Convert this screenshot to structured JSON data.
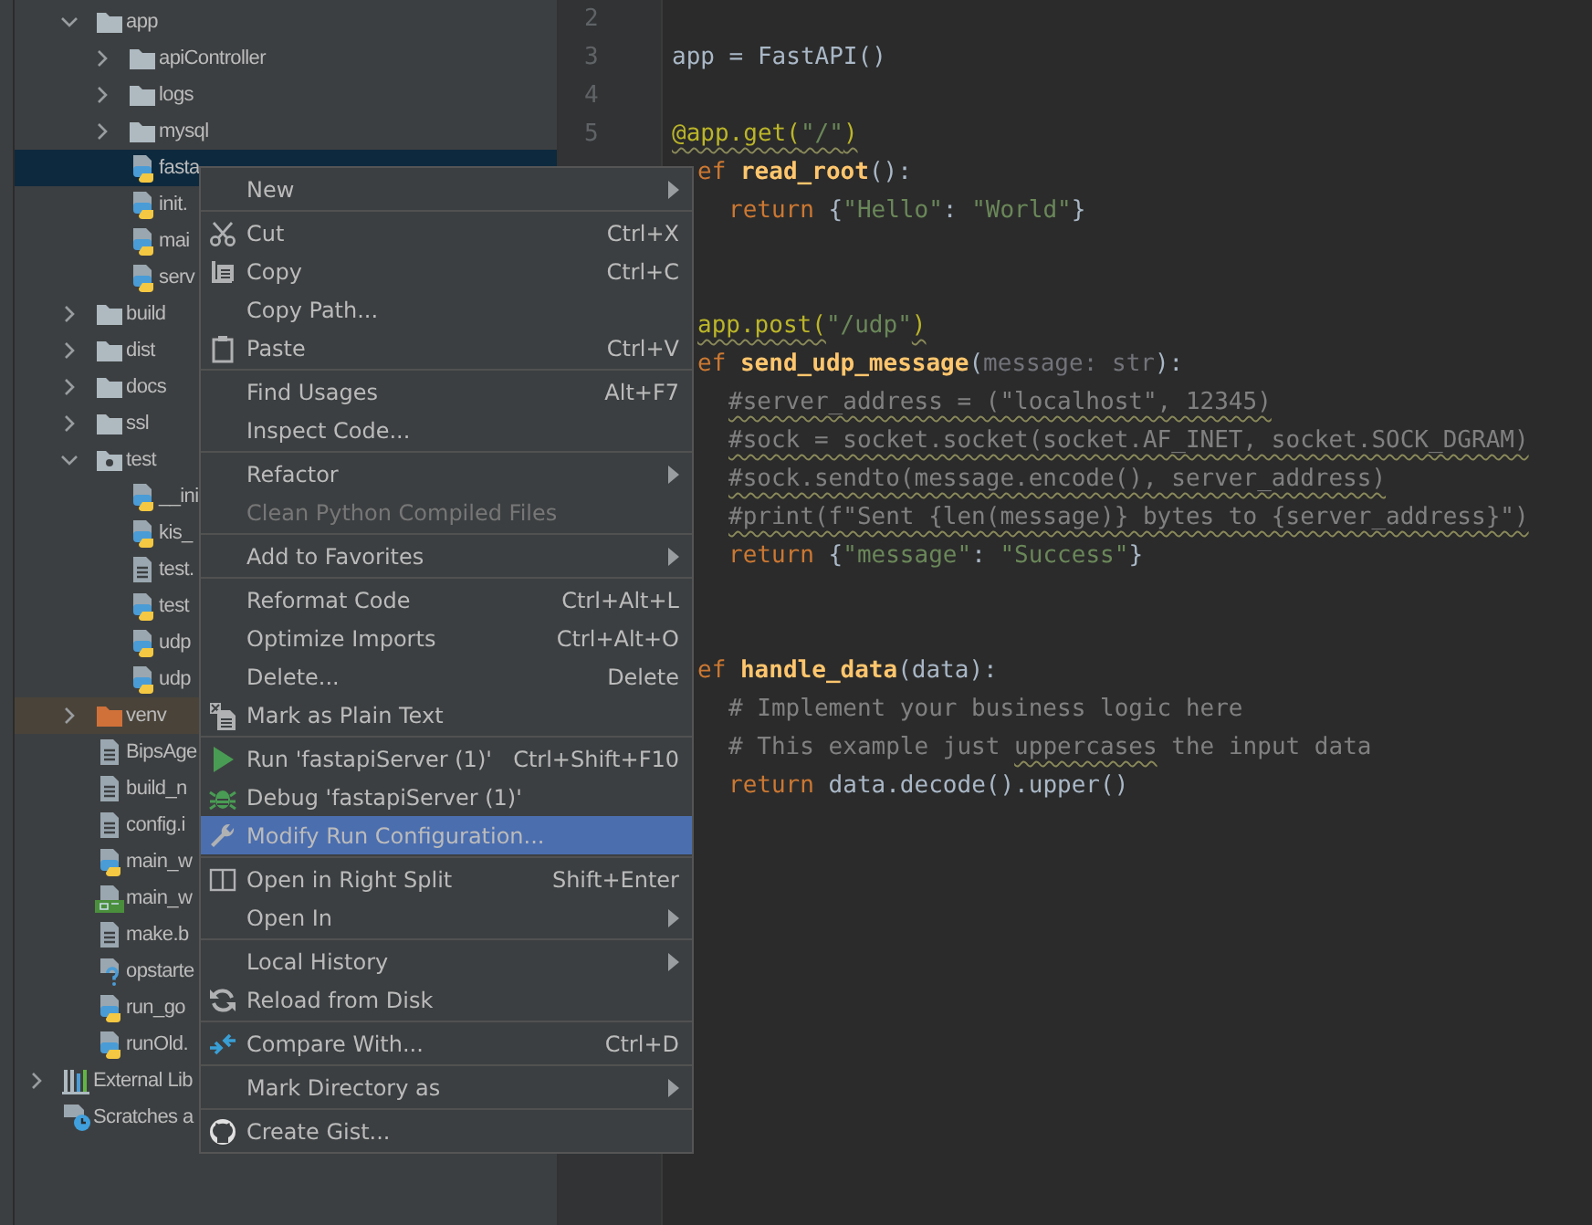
{
  "project_tree": {
    "items": [
      {
        "label": "app",
        "kind": "folder",
        "expanded": true,
        "selected": false,
        "children": [
          {
            "label": "apiController",
            "kind": "folder",
            "expanded": false,
            "selected": false
          },
          {
            "label": "logs",
            "kind": "folder",
            "expanded": false,
            "selected": false
          },
          {
            "label": "mysql",
            "kind": "folder",
            "expanded": false,
            "selected": false
          },
          {
            "label": "fasta",
            "kind": "python",
            "selected": true
          },
          {
            "label": "init.",
            "kind": "python",
            "selected": false
          },
          {
            "label": "mai",
            "kind": "python",
            "selected": false
          },
          {
            "label": "serv",
            "kind": "python",
            "selected": false
          }
        ]
      },
      {
        "label": "build",
        "kind": "folder",
        "expanded": false,
        "selected": false
      },
      {
        "label": "dist",
        "kind": "folder",
        "expanded": false,
        "selected": false
      },
      {
        "label": "docs",
        "kind": "folder",
        "expanded": false,
        "selected": false
      },
      {
        "label": "ssl",
        "kind": "folder",
        "expanded": false,
        "selected": false
      },
      {
        "label": "test",
        "kind": "test-folder",
        "expanded": true,
        "selected": false,
        "children": [
          {
            "label": "__ini",
            "kind": "python",
            "selected": false
          },
          {
            "label": "kis_",
            "kind": "python",
            "selected": false
          },
          {
            "label": "test.",
            "kind": "text",
            "selected": false
          },
          {
            "label": "test",
            "kind": "python",
            "selected": false
          },
          {
            "label": "udp",
            "kind": "python",
            "selected": false
          },
          {
            "label": "udp",
            "kind": "python",
            "selected": false
          }
        ]
      },
      {
        "label": "venv",
        "kind": "excluded-folder",
        "expanded": false,
        "selected": false
      },
      {
        "label": "BipsAge",
        "kind": "text",
        "selected": false
      },
      {
        "label": "build_n",
        "kind": "text",
        "selected": false
      },
      {
        "label": "config.i",
        "kind": "text",
        "selected": false
      },
      {
        "label": "main_w",
        "kind": "python",
        "selected": false
      },
      {
        "label": "main_w",
        "kind": "qt-ui",
        "selected": false
      },
      {
        "label": "make.b",
        "kind": "text",
        "selected": false
      },
      {
        "label": "opstarte",
        "kind": "python-unknown",
        "selected": false
      },
      {
        "label": "run_go",
        "kind": "python",
        "selected": false
      },
      {
        "label": "runOld.",
        "kind": "python",
        "selected": false
      }
    ],
    "root_items": [
      {
        "label": "External Lib",
        "kind": "libraries",
        "expanded": false,
        "selected": false
      },
      {
        "label": "Scratches a",
        "kind": "scratches",
        "selected": false
      }
    ]
  },
  "editor": {
    "lines": [
      {
        "number": "2",
        "kind": "blank"
      },
      {
        "number": "3",
        "kind": "top",
        "segments": [
          {
            "text": "app = FastAPI()",
            "kind": "plain"
          }
        ]
      },
      {
        "number": "4",
        "kind": "blank"
      },
      {
        "number": "5",
        "kind": "top",
        "segments": [
          {
            "text": "@app.get(",
            "kind": "decorator"
          },
          {
            "text": "\"/\"",
            "kind": "decorator-string"
          },
          {
            "text": ")",
            "kind": "decorator"
          }
        ]
      },
      {
        "kind": "cut",
        "segments": [
          {
            "text": "ef ",
            "kind": "keyword"
          },
          {
            "text": "read_root",
            "kind": "function"
          },
          {
            "text": "():",
            "kind": "plain"
          }
        ]
      },
      {
        "kind": "indented",
        "segments": [
          {
            "text": "return ",
            "kind": "keyword"
          },
          {
            "text": "{",
            "kind": "plain"
          },
          {
            "text": "\"Hello\"",
            "kind": "string"
          },
          {
            "text": ": ",
            "kind": "plain"
          },
          {
            "text": "\"World\"",
            "kind": "string"
          },
          {
            "text": "}",
            "kind": "plain"
          }
        ]
      },
      {
        "kind": "blank"
      },
      {
        "kind": "blank"
      },
      {
        "kind": "cut",
        "segments": [
          {
            "text": "app.post(",
            "kind": "decorator"
          },
          {
            "text": "\"/udp\"",
            "kind": "string"
          },
          {
            "text": ")",
            "kind": "decorator"
          }
        ]
      },
      {
        "kind": "cut",
        "segments": [
          {
            "text": "ef ",
            "kind": "keyword"
          },
          {
            "text": "send_udp_message",
            "kind": "function"
          },
          {
            "text": "(",
            "kind": "plain"
          },
          {
            "text": "message: str",
            "kind": "param"
          },
          {
            "text": "):",
            "kind": "plain"
          }
        ]
      },
      {
        "kind": "indented",
        "segments": [
          {
            "text": "#server_address = (\"localhost\", 12345)",
            "kind": "commented-code"
          }
        ]
      },
      {
        "kind": "indented",
        "segments": [
          {
            "text": "#sock = socket.socket(socket.AF_INET, socket.SOCK_DGRAM)",
            "kind": "commented-code"
          }
        ]
      },
      {
        "kind": "indented",
        "segments": [
          {
            "text": "#sock.sendto(message.encode(), server_address)",
            "kind": "commented-code"
          }
        ]
      },
      {
        "kind": "indented",
        "segments": [
          {
            "text": "#print(f\"Sent {len(message)} bytes to {server_address}\")",
            "kind": "commented-code"
          }
        ]
      },
      {
        "kind": "indented",
        "segments": [
          {
            "text": "return ",
            "kind": "keyword"
          },
          {
            "text": "{",
            "kind": "plain"
          },
          {
            "text": "\"message\"",
            "kind": "string"
          },
          {
            "text": ": ",
            "kind": "plain"
          },
          {
            "text": "\"Success\"",
            "kind": "string"
          },
          {
            "text": "}",
            "kind": "plain"
          }
        ]
      },
      {
        "kind": "blank"
      },
      {
        "kind": "blank"
      },
      {
        "kind": "cut",
        "segments": [
          {
            "text": "ef ",
            "kind": "keyword"
          },
          {
            "text": "handle_data",
            "kind": "function"
          },
          {
            "text": "(data):",
            "kind": "plain"
          }
        ]
      },
      {
        "kind": "indented",
        "segments": [
          {
            "text": "# Implement your business logic here",
            "kind": "comment"
          }
        ]
      },
      {
        "kind": "indented",
        "segments": [
          {
            "text": "# This example just ",
            "kind": "comment"
          },
          {
            "text": "uppercases",
            "kind": "typo-comment"
          },
          {
            "text": " the input data",
            "kind": "comment"
          }
        ]
      },
      {
        "kind": "indented",
        "segments": [
          {
            "text": "return ",
            "kind": "keyword"
          },
          {
            "text": "data.decode().upper()",
            "kind": "plain"
          }
        ]
      }
    ]
  },
  "context_menu": {
    "items": [
      {
        "kind": "item",
        "label": "New",
        "submenu": true,
        "disabled": false,
        "selected": false
      },
      {
        "kind": "separator"
      },
      {
        "kind": "item",
        "label": "Cut",
        "shortcut": "Ctrl+X",
        "submenu": false,
        "disabled": false,
        "selected": false
      },
      {
        "kind": "item",
        "label": "Copy",
        "shortcut": "Ctrl+C",
        "submenu": false,
        "disabled": false,
        "selected": false
      },
      {
        "kind": "item",
        "label": "Copy Path...",
        "submenu": false,
        "disabled": false,
        "selected": false
      },
      {
        "kind": "item",
        "label": "Paste",
        "shortcut": "Ctrl+V",
        "submenu": false,
        "disabled": false,
        "selected": false
      },
      {
        "kind": "separator"
      },
      {
        "kind": "item",
        "label": "Find Usages",
        "shortcut": "Alt+F7",
        "submenu": false,
        "disabled": false,
        "selected": false
      },
      {
        "kind": "item",
        "label": "Inspect Code...",
        "submenu": false,
        "disabled": false,
        "selected": false
      },
      {
        "kind": "separator"
      },
      {
        "kind": "item",
        "label": "Refactor",
        "submenu": true,
        "disabled": false,
        "selected": false
      },
      {
        "kind": "item",
        "label": "Clean Python Compiled Files",
        "submenu": false,
        "disabled": true,
        "selected": false
      },
      {
        "kind": "separator"
      },
      {
        "kind": "item",
        "label": "Add to Favorites",
        "submenu": true,
        "disabled": false,
        "selected": false
      },
      {
        "kind": "separator"
      },
      {
        "kind": "item",
        "label": "Reformat Code",
        "shortcut": "Ctrl+Alt+L",
        "submenu": false,
        "disabled": false,
        "selected": false
      },
      {
        "kind": "item",
        "label": "Optimize Imports",
        "shortcut": "Ctrl+Alt+O",
        "submenu": false,
        "disabled": false,
        "selected": false
      },
      {
        "kind": "item",
        "label": "Delete...",
        "shortcut": "Delete",
        "submenu": false,
        "disabled": false,
        "selected": false
      },
      {
        "kind": "item",
        "label": "Mark as Plain Text",
        "submenu": false,
        "disabled": false,
        "selected": false
      },
      {
        "kind": "separator"
      },
      {
        "kind": "item",
        "label": "Run 'fastapiServer (1)'",
        "shortcut": "Ctrl+Shift+F10",
        "submenu": false,
        "disabled": false,
        "selected": false
      },
      {
        "kind": "item",
        "label": "Debug 'fastapiServer (1)'",
        "submenu": false,
        "disabled": false,
        "selected": false
      },
      {
        "kind": "item",
        "label": "Modify Run Configuration...",
        "submenu": false,
        "disabled": false,
        "selected": true
      },
      {
        "kind": "separator"
      },
      {
        "kind": "item",
        "label": "Open in Right Split",
        "shortcut": "Shift+Enter",
        "submenu": false,
        "disabled": false,
        "selected": false
      },
      {
        "kind": "item",
        "label": "Open In",
        "submenu": true,
        "disabled": false,
        "selected": false
      },
      {
        "kind": "separator"
      },
      {
        "kind": "item",
        "label": "Local History",
        "submenu": true,
        "disabled": false,
        "selected": false
      },
      {
        "kind": "item",
        "label": "Reload from Disk",
        "submenu": false,
        "disabled": false,
        "selected": false
      },
      {
        "kind": "separator"
      },
      {
        "kind": "item",
        "label": "Compare With...",
        "shortcut": "Ctrl+D",
        "submenu": false,
        "disabled": false,
        "selected": false
      },
      {
        "kind": "separator"
      },
      {
        "kind": "item",
        "label": "Mark Directory as",
        "submenu": true,
        "disabled": false,
        "selected": false
      },
      {
        "kind": "separator"
      },
      {
        "kind": "item",
        "label": "Create Gist...",
        "submenu": false,
        "disabled": false,
        "selected": false
      }
    ]
  }
}
